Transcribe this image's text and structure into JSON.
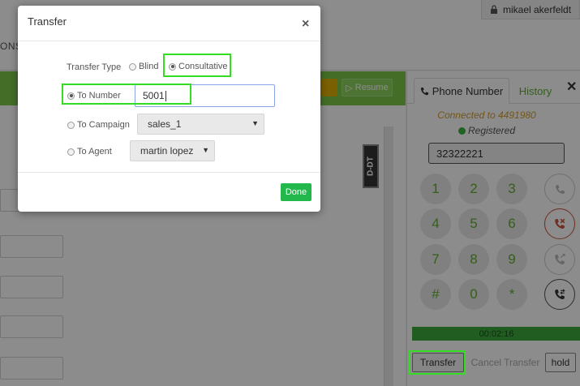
{
  "header": {
    "nav_fragment": "ONS",
    "user_name": "mikael akerfeldt",
    "user_icon": "lock-icon"
  },
  "toolbar": {
    "resume_label": "Resume",
    "resume_icon": "play-icon"
  },
  "logo_text": "D-DT",
  "phone_panel": {
    "tabs": [
      {
        "label": "Phone Number",
        "icon": "phone-icon",
        "active": true
      },
      {
        "label": "History",
        "active": false
      }
    ],
    "connected_text": "Connected to 4491980",
    "registered_text": "Registered",
    "dial_value": "32322221",
    "keys": [
      "1",
      "2",
      "3",
      "4",
      "5",
      "6",
      "7",
      "8",
      "9",
      "#",
      "0",
      "*"
    ],
    "actions": [
      "call-icon",
      "hangup-icon",
      "call-forward-icon",
      "call-transfer-icon"
    ],
    "timer": "00:02:16",
    "transfer_label": "Transfer",
    "cancel_transfer_label": "Cancel Transfer",
    "hold_label": "hold"
  },
  "modal": {
    "title": "Transfer",
    "close_symbol": "×",
    "transfer_type_label": "Transfer Type",
    "type_options": [
      {
        "label": "Blind",
        "checked": false
      },
      {
        "label": "Consultative",
        "checked": true
      }
    ],
    "to_number_label": "To Number",
    "to_number_value": "5001",
    "to_campaign_label": "To Campaign",
    "campaign_selected": "sales_1",
    "to_agent_label": "To Agent",
    "agent_selected": "martin lopez",
    "done_label": "Done"
  },
  "colors": {
    "accent_green": "#7cc84a",
    "done_green": "#22b84c",
    "highlight": "#33dd22",
    "connected_orange": "#d39c2a"
  }
}
